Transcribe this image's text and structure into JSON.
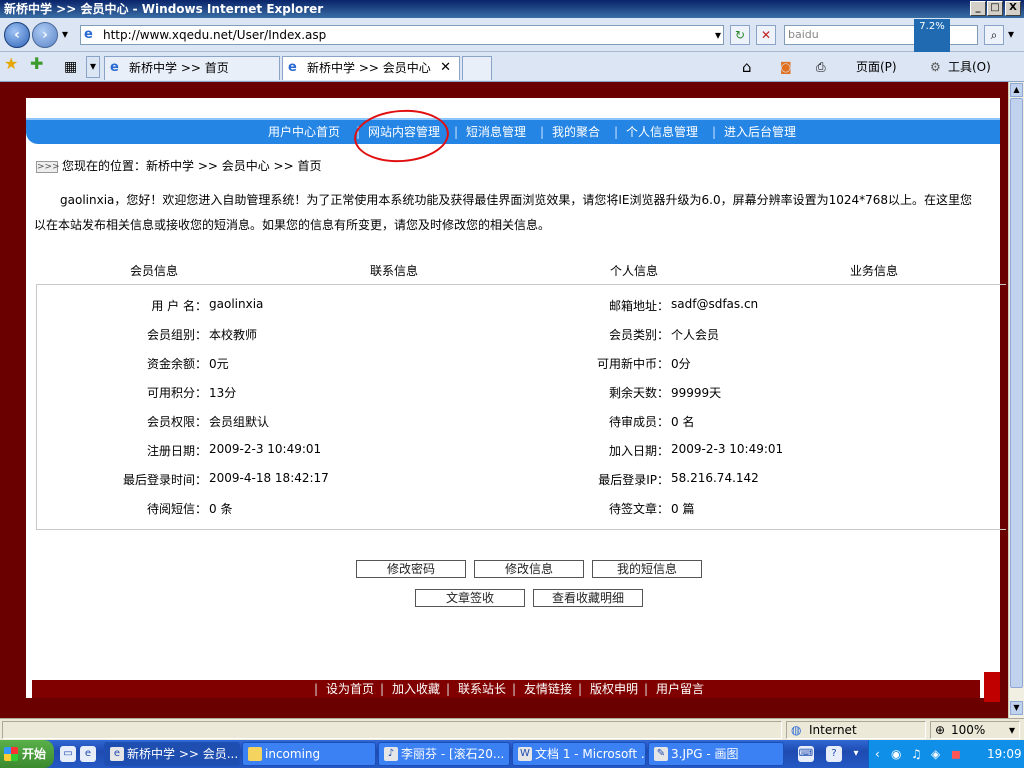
{
  "window": {
    "title": "新桥中学 >> 会员中心 - Windows Internet Explorer",
    "min": "_",
    "max": "□",
    "close": "X"
  },
  "toolbar": {
    "address": "http://www.xqedu.net/User/Index.asp",
    "search_placeholder": "baidu",
    "net_speed": "7.2%",
    "page_menu": "页面(P)",
    "tools_menu": "工具(O)"
  },
  "tabs": [
    {
      "label": "新桥中学 >> 首页"
    },
    {
      "label": "新桥中学 >> 会员中心"
    }
  ],
  "nav": {
    "items": [
      "用户中心首页",
      "网站内容管理",
      "短消息管理",
      "我的聚合",
      "个人信息管理",
      "进入后台管理"
    ],
    "separator": "|"
  },
  "breadcrumb": {
    "icon_text": ">>>",
    "text": "您现在的位置：新桥中学 >> 会员中心 >> 首页"
  },
  "welcome": {
    "line1": "gaolinxia，您好！欢迎您进入自助管理系统！为了正常使用本系统功能及获得最佳界面浏览效果，请您将IE浏览器升级为6.0，屏幕分辨率设置为1024*768以上。在这里您",
    "line2": "以在本站发布相关信息或接收您的短消息。如果您的信息有所变更，请您及时修改您的相关信息。"
  },
  "columns": [
    "会员信息",
    "联系信息",
    "个人信息",
    "业务信息"
  ],
  "info_left": [
    {
      "label": "用 户 名：",
      "value": "gaolinxia"
    },
    {
      "label": "会员组别：",
      "value": "本校教师"
    },
    {
      "label": "资金余额：",
      "value": "0元"
    },
    {
      "label": "可用积分：",
      "value": "13分"
    },
    {
      "label": "会员权限：",
      "value": "会员组默认"
    },
    {
      "label": "注册日期：",
      "value": "2009-2-3 10:49:01"
    },
    {
      "label": "最后登录时间：",
      "value": "2009-4-18 18:42:17"
    },
    {
      "label": "待阅短信：",
      "value": "0 条"
    }
  ],
  "info_right": [
    {
      "label": "邮箱地址：",
      "value": "sadf@sdfas.cn"
    },
    {
      "label": "会员类别：",
      "value": "个人会员"
    },
    {
      "label": "可用新中币：",
      "value": "0分"
    },
    {
      "label": "剩余天数：",
      "value": "99999天"
    },
    {
      "label": "待审成员：",
      "value": "0 名"
    },
    {
      "label": "加入日期：",
      "value": "2009-2-3 10:49:01"
    },
    {
      "label": "最后登录IP：",
      "value": "58.216.74.142"
    },
    {
      "label": "待签文章：",
      "value": "0 篇"
    }
  ],
  "buttons": [
    "修改密码",
    "修改信息",
    "我的短信息",
    "文章签收",
    "查看收藏明细"
  ],
  "footer": [
    "设为首页",
    "加入收藏",
    "联系站长",
    "友情链接",
    "版权申明",
    "用户留言"
  ],
  "status": {
    "zone": "Internet",
    "zoom": "100%"
  },
  "taskbar": {
    "start": "开始",
    "tasks": [
      "新桥中学 >> 会员...",
      "incoming",
      "李丽芬 - [滚石20...",
      "文档 1 - Microsoft ...",
      "3.JPG - 画图"
    ],
    "clock": "19:09"
  },
  "colors": {
    "nav_blue": "#2585e4",
    "frame_red": "#6b0000",
    "annotation_red": "#e01010"
  }
}
